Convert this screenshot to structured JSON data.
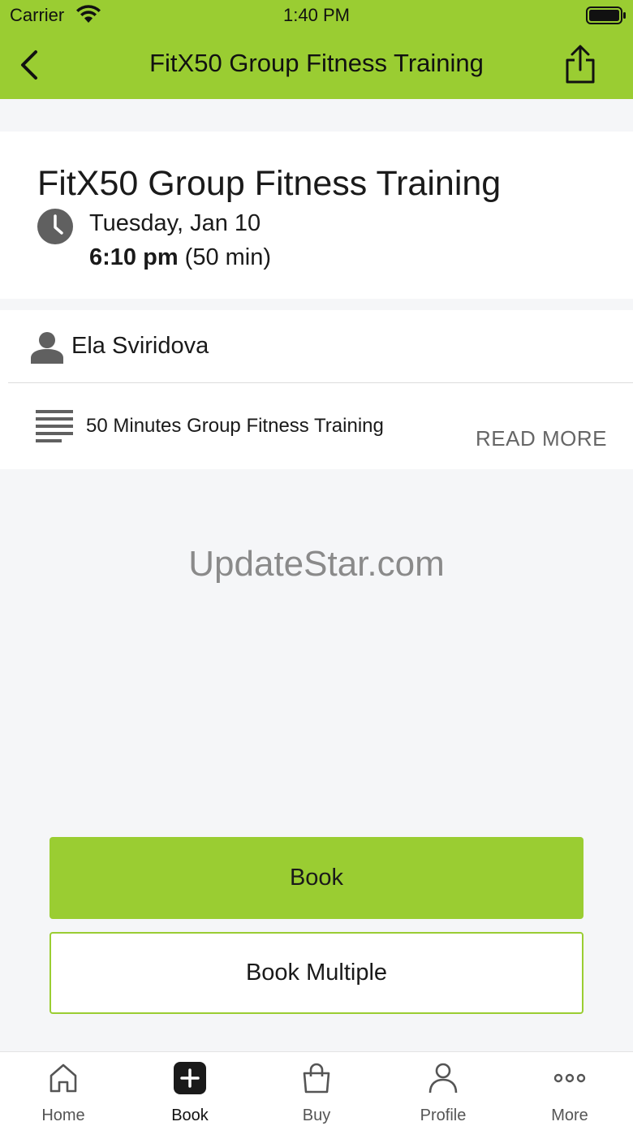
{
  "status_bar": {
    "carrier": "Carrier",
    "time": "1:40 PM"
  },
  "nav": {
    "title": "FitX50 Group Fitness Training"
  },
  "class": {
    "title": "FitX50 Group Fitness Training",
    "date": "Tuesday, Jan 10",
    "time_bold": "6:10 pm",
    "duration": " (50 min)",
    "instructor": "Ela Sviridova",
    "description": "50 Minutes Group Fitness Training",
    "read_more": "READ MORE"
  },
  "watermark": "UpdateStar.com",
  "buttons": {
    "book": "Book",
    "book_multiple": "Book Multiple"
  },
  "tabs": [
    {
      "label": "Home",
      "icon": "home-icon"
    },
    {
      "label": "Book",
      "icon": "plus-icon"
    },
    {
      "label": "Buy",
      "icon": "shopping-bag-icon"
    },
    {
      "label": "Profile",
      "icon": "profile-icon"
    },
    {
      "label": "More",
      "icon": "more-icon"
    }
  ],
  "colors": {
    "accent": "#9acd32",
    "background": "#f5f6f8"
  }
}
